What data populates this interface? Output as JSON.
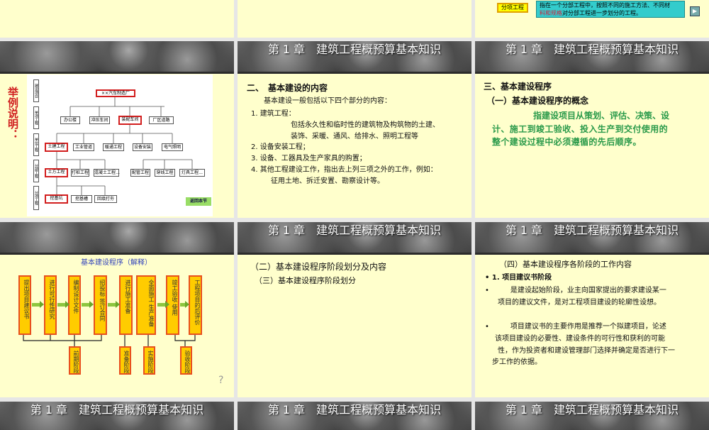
{
  "header_title": "第 1 章　建筑工程概预算基本知识",
  "slide3_top": {
    "label": "分项工程",
    "callout_line1": "指在一个分部工程中，按照不同的施工方法、不同材",
    "callout_line2_red": "料和规格",
    "callout_line2": "对分部工程进一步划分的工程。",
    "nav_icon": "play-next-icon"
  },
  "slide4": {
    "side_title": "举例说明：",
    "levels": [
      "建设项目",
      "单项工程",
      "单位工程",
      "分部工程",
      "分项工程"
    ],
    "nodes": {
      "root": "××汽车制造厂",
      "l2": [
        "办公楼",
        "冲压车间",
        "装配车间",
        "厂区道路"
      ],
      "l3": [
        "土建工程",
        "工业管道",
        "暖通工程",
        "设备安装",
        "电气照明"
      ],
      "l4": [
        "土方工程",
        "打桩工程",
        "混凝土工程…",
        "配管工程",
        "穿线工程",
        "灯具工程…"
      ],
      "l5": [
        "挖基坑",
        "挖基槽",
        "回填打夯"
      ]
    },
    "back_button": "返回本节"
  },
  "slide5": {
    "heading": "二、　基本建设的内容",
    "intro": "基本建设一般包括以下四个部分的内容：",
    "items": [
      "1. 建筑工程：",
      "包括永久性和临时性的建筑物及构筑物的土建、",
      "装饰、采暖、通风、给排水、照明工程等",
      "2. 设备安装工程；",
      "3. 设备、工器具及生产家具的购置；",
      "4. 其他工程建设工作，指出去上列三项之外的工作，例如：",
      "征用土地、拆迁安置、勘察设计等。"
    ]
  },
  "slide6": {
    "heading": "三、基本建设程序",
    "subheading": "（一）基本建设程序的概念",
    "body": [
      "指建设项目从策划、评估、决策、设",
      "计、施工到竣工验收、投入生产到交付使用的",
      "整个建设过程中必须遵循的先后顺序。"
    ]
  },
  "slide7": {
    "title": "基本建设程序（解释）",
    "steps": [
      "提出项目建议书",
      "进行可行性研究",
      "编制设计文件",
      "招投标 签订合同",
      "进行施工准备",
      "全面施工 生产准备",
      "竣工验收 使用",
      "工程项目的后评价"
    ],
    "phases": [
      "前期阶段",
      "准备阶段",
      "实施阶段",
      "验收阶段"
    ],
    "help_icon": "?"
  },
  "slide8": {
    "lines": [
      "（二）基本建设程序阶段划分及内容",
      "（三）基本建设程序阶段划分"
    ]
  },
  "slide9": {
    "heading": "（四）基本建设程序各阶段的工作内容",
    "bullets": [
      "• 1. 项目建议书阶段",
      "•　　　是建设起始阶段，业主向国家提出的要求建设某一",
      "项目的建议文件，是对工程项目建设的轮廓性设想。",
      "•　　　项目建议书的主要作用是推荐一个拟建项目，论述",
      "该项目建设的必要性、建设条件的可行性和获利的可能",
      "性，作为投资者和建设管理部门选择并确定是否进行下一",
      "步工作的依据。"
    ]
  }
}
